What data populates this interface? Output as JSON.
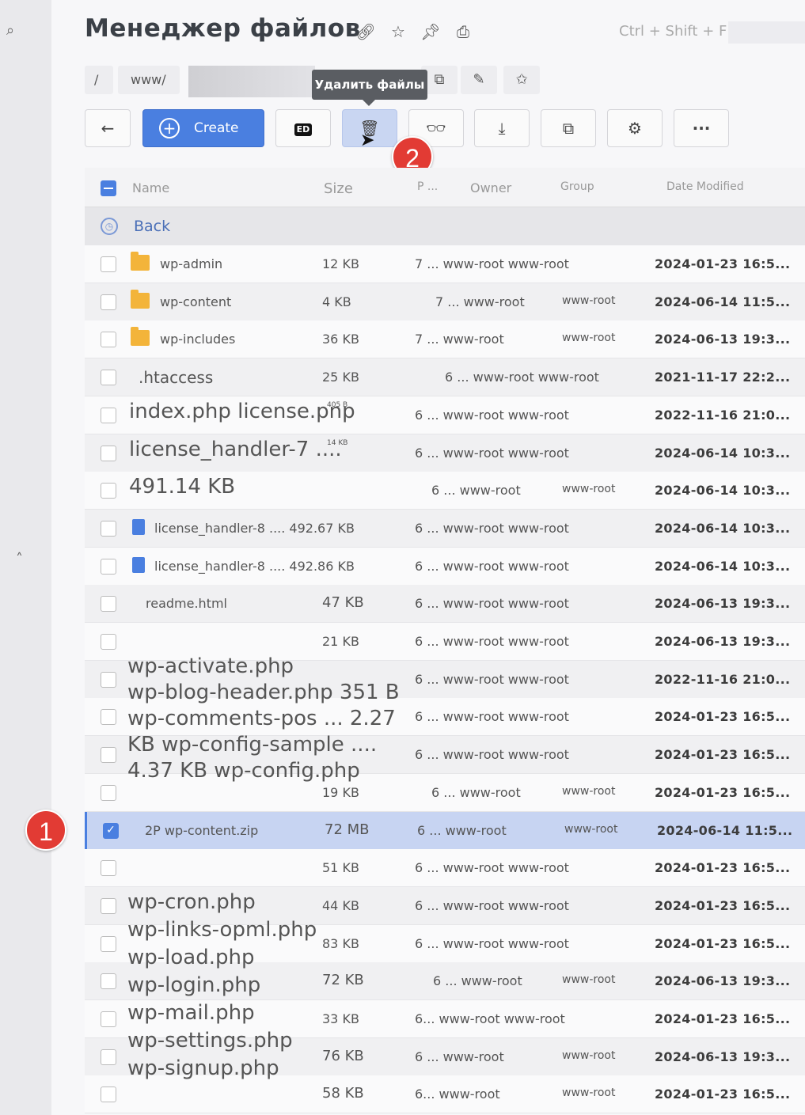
{
  "app": {
    "title": "Менеджер файлов",
    "shortcut": "Ctrl + Shift + F"
  },
  "breadcrumb": {
    "root": "/",
    "current": "www/"
  },
  "tooltip": "Удалить файлы",
  "toolbar": {
    "create_label": "Create",
    "ed_label": "ED",
    "more_label": "···"
  },
  "markers": {
    "one": "1",
    "two": "2"
  },
  "columns": {
    "name": "Name",
    "size": "Size",
    "perms": "P ...",
    "owner": "Owner",
    "group": "Group",
    "date": "Date Modified"
  },
  "back_row": {
    "label": "Back"
  },
  "rows": [
    {
      "name": "wp-admin",
      "size": "12 KB",
      "perm": "7 ... www-root www-root",
      "group": "",
      "date": "2024-01-23 16:5..."
    },
    {
      "name": "wp-content",
      "size": "4 KB",
      "perm": "7 ... www-root",
      "group": "www-root",
      "date": "2024-06-14 11:5..."
    },
    {
      "name": "wp-includes",
      "size": "36 KB",
      "perm": "7 ... www-root",
      "group": "www-root",
      "date": "2024-06-13 19:3..."
    },
    {
      "name": ".htaccess",
      "size": "25 KB",
      "perm": "6 ... www-root www-root",
      "group": "",
      "date": "2021-11-17 22:2..."
    },
    {
      "name": "index.php license.pnp",
      "size": "405 B",
      "perm": "6 ... www-root www-root",
      "group": "",
      "date": "2022-11-16 21:0..."
    },
    {
      "name": "license_handler-7 ....",
      "size": "14 KB",
      "perm": "6 ... www-root www-root",
      "group": "",
      "date": "2024-06-14 10:3..."
    },
    {
      "name": "491.14 KB",
      "size": "",
      "perm": "6 ... www-root",
      "group": "www-root",
      "date": "2024-06-14 10:3..."
    },
    {
      "name": "license_handler-8 .... 492.67 KB",
      "size": "",
      "perm": "6 ... www-root www-root",
      "group": "",
      "date": "2024-06-14 10:3..."
    },
    {
      "name": "license_handler-8 .... 492.86 KB",
      "size": "",
      "perm": "6 ... www-root www-root",
      "group": "",
      "date": "2024-06-14 10:3..."
    },
    {
      "name": "readme.html",
      "size": "47 KB",
      "perm": "6 ... www-root www-root",
      "group": "",
      "date": "2024-06-13 19:3..."
    },
    {
      "name": "",
      "size": "21 KB",
      "perm": "6 ... www-root www-root",
      "group": "",
      "date": "2024-06-13 19:3..."
    },
    {
      "name": "",
      "size": "",
      "perm": "6 ... www-root www-root",
      "group": "",
      "date": "2022-11-16 21:0..."
    },
    {
      "name": "",
      "size": "",
      "perm": "6 ... www-root www-root",
      "group": "",
      "date": "2024-01-23 16:5..."
    },
    {
      "name": "",
      "size": "",
      "perm": "6 ... www-root www-root",
      "group": "",
      "date": "2024-01-23 16:5..."
    },
    {
      "name": "",
      "size": "19 KB",
      "perm": "6 ... www-root",
      "group": "www-root",
      "date": "2024-01-23 16:5..."
    },
    {
      "name": "2P wp-content.zip",
      "size": "72 MB",
      "perm": "6 ... www-root",
      "group": "www-root",
      "date": "2024-06-14 11:5...",
      "selected": true
    },
    {
      "name": "",
      "size": "51 KB",
      "perm": "6 ... www-root www-root",
      "group": "",
      "date": "2024-01-23 16:5..."
    },
    {
      "name": "",
      "size": "44 KB",
      "perm": "6 ... www-root www-root",
      "group": "",
      "date": "2024-01-23 16:5..."
    },
    {
      "name": "",
      "size": "83 KB",
      "perm": "6 ... www-root www-root",
      "group": "",
      "date": "2024-01-23 16:5..."
    },
    {
      "name": "",
      "size": "72 KB",
      "perm": "6 ... www-root",
      "group": "www-root",
      "date": "2024-06-13 19:3..."
    },
    {
      "name": "",
      "size": "33 KB",
      "perm": "6... www-root www-root",
      "group": "",
      "date": "2024-01-23 16:5..."
    },
    {
      "name": "",
      "size": "76 KB",
      "perm": "6 ... www-root",
      "group": "www-root",
      "date": "2024-06-13 19:3..."
    },
    {
      "name": "",
      "size": "58 KB",
      "perm": "6... www-root",
      "group": "www-root",
      "date": "2024-01-23 16:5..."
    }
  ],
  "overflow_text_1": [
    "wp-activate.php",
    "wp-blog-header.php 351 B",
    "wp-comments-pos ... 2.27",
    "KB wp-config-sample ....",
    "4.37 KB wp-config.php"
  ],
  "overflow_text_2": [
    "wp-cron.php",
    "wp-links-opml.php",
    "wp-load.php",
    "wp-login.php",
    "wp-mail.php",
    "wp-settings.php",
    "wp-signup.php"
  ]
}
